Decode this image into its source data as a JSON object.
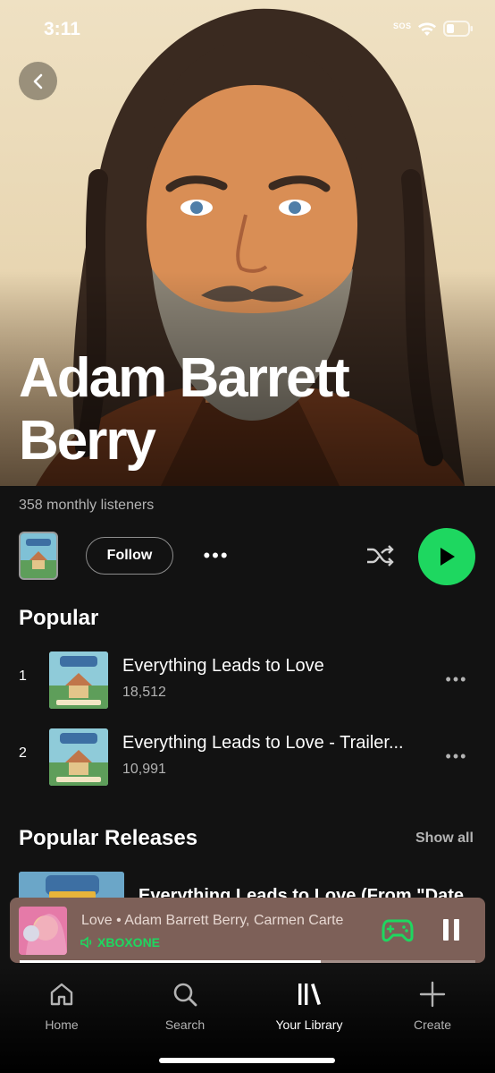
{
  "status_bar": {
    "time": "3:11",
    "carrier": "SOS"
  },
  "artist": {
    "name_line1": "Adam Barrett",
    "name_line2": "Berry",
    "monthly_listeners": "358 monthly listeners"
  },
  "controls": {
    "follow_label": "Follow",
    "more_label": "•••"
  },
  "popular": {
    "title": "Popular",
    "tracks": [
      {
        "number": "1",
        "title": "Everything Leads to Love",
        "plays": "18,512"
      },
      {
        "number": "2",
        "title": "Everything Leads to Love - Trailer...",
        "plays": "10,991"
      }
    ]
  },
  "popular_releases": {
    "title": "Popular Releases",
    "show_all": "Show all",
    "first_release_title": "Everything Leads to Love (From \"Date"
  },
  "now_playing": {
    "title": "Love • Adam Barrett Berry, Carmen Carte",
    "device": "XBOXONE",
    "progress": 0.66
  },
  "tabbar": {
    "tabs": [
      {
        "label": "Home",
        "icon": "home-icon",
        "active": false
      },
      {
        "label": "Search",
        "icon": "search-icon",
        "active": false
      },
      {
        "label": "Your Library",
        "icon": "library-icon",
        "active": true
      },
      {
        "label": "Create",
        "icon": "plus-icon",
        "active": false
      }
    ]
  },
  "colors": {
    "accent": "#1ed760",
    "background": "#121212",
    "now_playing_bg": "#7d6058",
    "secondary_text": "#b3b3b3"
  }
}
